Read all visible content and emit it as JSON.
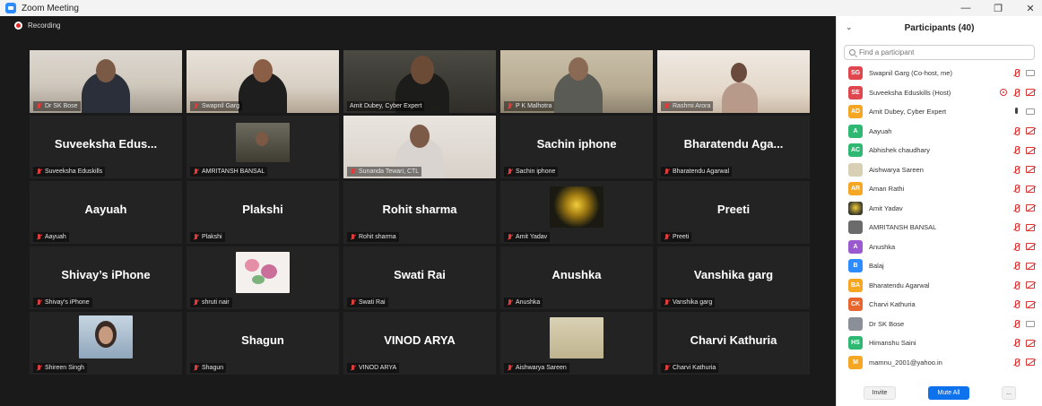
{
  "window": {
    "title": "Zoom Meeting",
    "controls": {
      "minimize": "—",
      "restore": "❐",
      "close": "✕"
    }
  },
  "recording": {
    "label": "Recording",
    "color": "#e02828"
  },
  "tiles": [
    {
      "name": "Dr SK Bose",
      "big": ""
    },
    {
      "name": "Swapnil Garg",
      "big": ""
    },
    {
      "name": "Amit Dubey, Cyber Expert",
      "big": "",
      "active": true
    },
    {
      "name": "P K Malhotra",
      "big": ""
    },
    {
      "name": "Rashmi Arora",
      "big": ""
    },
    {
      "name": "Suveeksha Eduskills",
      "big": "Suveeksha  Edus..."
    },
    {
      "name": "AMRITANSH BANSAL",
      "big": ""
    },
    {
      "name": "Sunanda Tewari, CTL",
      "big": ""
    },
    {
      "name": "Sachin iphone",
      "big": "Sachin iphone"
    },
    {
      "name": "Bharatendu Agarwal",
      "big": "Bharatendu  Aga..."
    },
    {
      "name": "Aayuah",
      "big": "Aayuah"
    },
    {
      "name": "Plakshi",
      "big": "Plakshi"
    },
    {
      "name": "Rohit sharma",
      "big": "Rohit sharma"
    },
    {
      "name": "Amit Yadav",
      "big": ""
    },
    {
      "name": "Preeti",
      "big": "Preeti"
    },
    {
      "name": "Shivay's iPhone",
      "big": "Shivay’s iPhone"
    },
    {
      "name": "shruti nair",
      "big": ""
    },
    {
      "name": "Swati Rai",
      "big": "Swati Rai"
    },
    {
      "name": "Anushka",
      "big": "Anushka"
    },
    {
      "name": "Vanshika garg",
      "big": "Vanshika garg"
    },
    {
      "name": "Shireen Singh",
      "big": ""
    },
    {
      "name": "Shagun",
      "big": "Shagun"
    },
    {
      "name": "VINOD ARYA",
      "big": "VINOD ARYA"
    },
    {
      "name": "Aishwarya Sareen",
      "big": ""
    },
    {
      "name": "Charvi Kathuria",
      "big": "Charvi Kathuria"
    }
  ],
  "panel": {
    "title": "Participants (40)",
    "collapse_icon": "chevron-down-icon",
    "search_placeholder": "Find a participant",
    "participants": [
      {
        "initials": "SG",
        "name": "Swapnil Garg (Co-host, me)",
        "color": "#e0464e"
      },
      {
        "initials": "SE",
        "name": "Suveeksha Eduskills (Host)",
        "color": "#e0464e"
      },
      {
        "initials": "AD",
        "name": "Amit Dubey, Cyber Expert",
        "color": "#f5a623"
      },
      {
        "initials": "A",
        "name": "Aayuah",
        "color": "#2fb872"
      },
      {
        "initials": "AC",
        "name": "Abhishek chaudhary",
        "color": "#2fb872"
      },
      {
        "initials": "",
        "name": "Aishwarya Sareen",
        "color": "#d8cfb5"
      },
      {
        "initials": "AR",
        "name": "Aman Rathi",
        "color": "#f5a623"
      },
      {
        "initials": "",
        "name": "Amit Yadav",
        "color": "#3a3a2a"
      },
      {
        "initials": "",
        "name": "AMRITANSH BANSAL",
        "color": "#6b6b6b"
      },
      {
        "initials": "A",
        "name": "Anushka",
        "color": "#9b59d0"
      },
      {
        "initials": "B",
        "name": "Balaj",
        "color": "#2d8cff"
      },
      {
        "initials": "BA",
        "name": "Bharatendu Agarwal",
        "color": "#f5a623"
      },
      {
        "initials": "CK",
        "name": "Charvi Kathuria",
        "color": "#e8662d"
      },
      {
        "initials": "",
        "name": "Dr SK Bose",
        "color": "#8a8f98"
      },
      {
        "initials": "HS",
        "name": "Himanshu Saini",
        "color": "#2fb872"
      },
      {
        "initials": "M",
        "name": "mamnu_2001@yahoo.in",
        "color": "#f5a623"
      }
    ],
    "invite_label": "Invite",
    "mute_all_label": "Mute All",
    "more_label": "..."
  }
}
